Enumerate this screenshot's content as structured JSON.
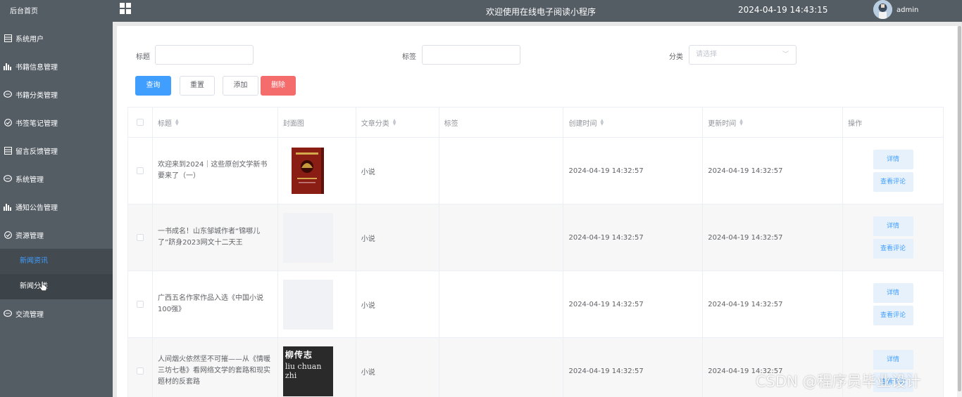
{
  "sidebar": {
    "home": "后台首页",
    "items": [
      {
        "label": "系统用户",
        "icon": "table-icon"
      },
      {
        "label": "书籍信息管理",
        "icon": "bar-chart-icon"
      },
      {
        "label": "书籍分类管理",
        "icon": "chat-icon"
      },
      {
        "label": "书签笔记管理",
        "icon": "check-circle-icon"
      },
      {
        "label": "留言反馈管理",
        "icon": "table-icon"
      },
      {
        "label": "系统管理",
        "icon": "chat-icon"
      },
      {
        "label": "通知公告管理",
        "icon": "bar-chart-icon"
      },
      {
        "label": "资源管理",
        "icon": "check-circle-icon"
      }
    ],
    "sub_items": [
      "新闻资讯",
      "新闻分类"
    ],
    "last_item": {
      "label": "交流管理",
      "icon": "chat-icon"
    }
  },
  "header": {
    "title": "欢迎使用在线电子阅读小程序",
    "datetime": "2024-04-19 14:43:15",
    "user": "admin"
  },
  "search": {
    "title_label": "标题",
    "tag_label": "标签",
    "category_label": "分类",
    "category_placeholder": "请选择"
  },
  "buttons": {
    "query": "查询",
    "reset": "重置",
    "add": "添加",
    "delete": "删除"
  },
  "table": {
    "headers": [
      "标题",
      "封面图",
      "文章分类",
      "标签",
      "创建时间",
      "更新时间",
      "操作"
    ],
    "rows": [
      {
        "title": "欢迎来到2024｜这些原创文学新书要来了（一）",
        "cover": "red-book",
        "category": "小说",
        "tag": "",
        "created": "2024-04-19 14:32:57",
        "updated": "2024-04-19 14:32:57"
      },
      {
        "title": "一书成名！山东邹城作者“锦哪儿了”跻身2023网文十二天王",
        "cover": "empty",
        "category": "小说",
        "tag": "",
        "created": "2024-04-19 14:32:57",
        "updated": "2024-04-19 14:32:57"
      },
      {
        "title": "广西五名作家作品入选《中国小说100强》",
        "cover": "empty",
        "category": "小说",
        "tag": "",
        "created": "2024-04-19 14:32:57",
        "updated": "2024-04-19 14:32:57"
      },
      {
        "title": "人间烟火依然坚不可摧——从《情暖三坊七巷》看网络文学的套路和现实题材的反套路",
        "cover": "liu-book",
        "category": "小说",
        "tag": "",
        "created": "2024-04-19 14:32:57",
        "updated": "2024-04-19 14:32:57"
      }
    ],
    "detail_label": "详情",
    "comment_label": "查看评论"
  },
  "cover_text": {
    "liu_top": "柳传志",
    "liu_mid": "liu chuan zhi"
  },
  "watermark": "CSDN @程序员毕业设计",
  "colors": {
    "sidebar_bg": "#545c64",
    "primary": "#409eff",
    "danger": "#f56c6c"
  }
}
